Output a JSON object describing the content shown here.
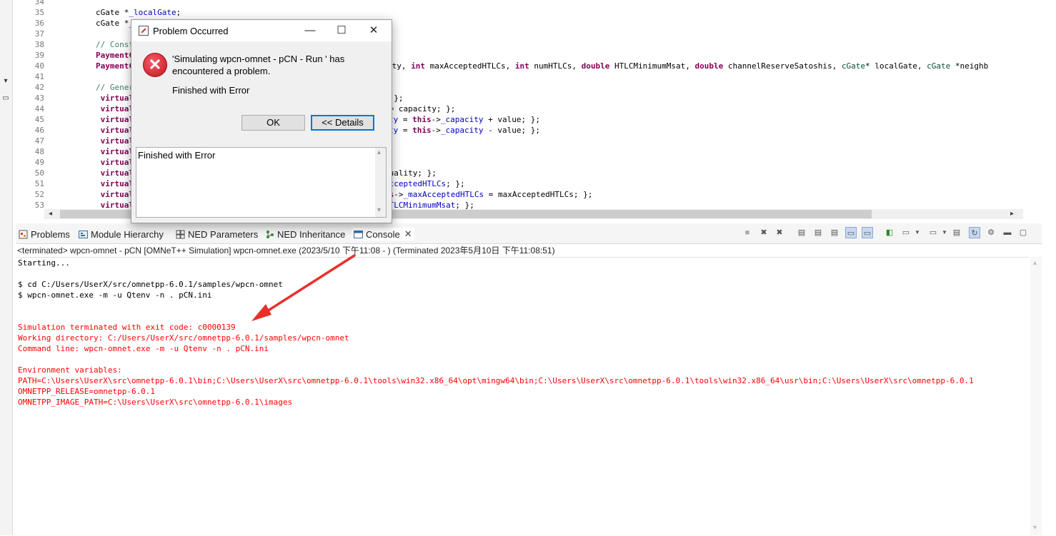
{
  "editor": {
    "lines": [
      {
        "no": "34",
        "segments": []
      },
      {
        "no": "35",
        "segments": [
          {
            "t": "        cGate *",
            "c": ""
          },
          {
            "t": "_localGate",
            "c": "fld"
          },
          {
            "t": ";",
            "c": ""
          }
        ]
      },
      {
        "no": "36",
        "segments": [
          {
            "t": "        cGate *",
            "c": ""
          },
          {
            "t": "_n",
            "c": "fld"
          }
        ]
      },
      {
        "no": "37",
        "segments": []
      },
      {
        "no": "38",
        "segments": [
          {
            "t": "        // Constr",
            "c": "cm"
          }
        ]
      },
      {
        "no": "39",
        "segments": [
          {
            "t": "        PaymentCh",
            "c": "kw"
          }
        ]
      },
      {
        "no": "40",
        "segments": [
          {
            "t": "        PaymentCh",
            "c": "kw"
          }
        ]
      },
      {
        "no": "41",
        "segments": []
      },
      {
        "no": "42",
        "segments": [
          {
            "t": "        // Generi",
            "c": "cm"
          }
        ]
      },
      {
        "no": "43",
        "segments": [
          {
            "t": "         virtual",
            "c": "kw"
          }
        ]
      },
      {
        "no": "44",
        "segments": [
          {
            "t": "         virtual",
            "c": "kw"
          }
        ]
      },
      {
        "no": "45",
        "segments": [
          {
            "t": "         virtual",
            "c": "kw"
          }
        ]
      },
      {
        "no": "46",
        "segments": [
          {
            "t": "         virtual",
            "c": "kw"
          }
        ]
      },
      {
        "no": "47",
        "segments": [
          {
            "t": "         virtual",
            "c": "kw"
          }
        ]
      },
      {
        "no": "48",
        "segments": [
          {
            "t": "         virtual",
            "c": "kw"
          }
        ]
      },
      {
        "no": "49",
        "segments": [
          {
            "t": "         virtual",
            "c": "kw"
          }
        ]
      },
      {
        "no": "50",
        "segments": [
          {
            "t": "         virtual",
            "c": "kw"
          }
        ]
      },
      {
        "no": "51",
        "segments": [
          {
            "t": "         virtual",
            "c": "kw"
          }
        ]
      },
      {
        "no": "52",
        "segments": [
          {
            "t": "         virtual",
            "c": "kw"
          }
        ]
      },
      {
        "no": "53",
        "segments": [
          {
            "t": "         virtual",
            "c": "kw"
          }
        ]
      }
    ],
    "right_fragments": [
      {
        "line": 40,
        "segments": [
          {
            "t": "ity, ",
            "c": ""
          },
          {
            "t": "int",
            "c": "kw"
          },
          {
            "t": " maxAcceptedHTLCs, ",
            "c": ""
          },
          {
            "t": "int",
            "c": "kw"
          },
          {
            "t": " numHTLCs, ",
            "c": ""
          },
          {
            "t": "double",
            "c": "kw"
          },
          {
            "t": " HTLCMinimumMsat, ",
            "c": ""
          },
          {
            "t": "double",
            "c": "kw"
          },
          {
            "t": " channelReserveSatoshis, ",
            "c": ""
          },
          {
            "t": "cGate",
            "c": "typ"
          },
          {
            "t": "* localGate, ",
            "c": ""
          },
          {
            "t": "cGate",
            "c": "typ"
          },
          {
            "t": " *neighb",
            "c": ""
          }
        ]
      },
      {
        "line": 43,
        "segments": [
          {
            "t": "; };",
            "c": ""
          }
        ]
      },
      {
        "line": 44,
        "segments": [
          {
            "t": " = capacity; };",
            "c": ""
          }
        ]
      },
      {
        "line": 45,
        "segments": [
          {
            "t": "ty",
            "c": "fld"
          },
          {
            "t": " = ",
            "c": ""
          },
          {
            "t": "this",
            "c": "kw"
          },
          {
            "t": "->",
            "c": ""
          },
          {
            "t": "_capacity",
            "c": "fld"
          },
          {
            "t": " + value; };",
            "c": ""
          }
        ]
      },
      {
        "line": 46,
        "segments": [
          {
            "t": "ty",
            "c": "fld"
          },
          {
            "t": " = ",
            "c": ""
          },
          {
            "t": "this",
            "c": "kw"
          },
          {
            "t": "->",
            "c": ""
          },
          {
            "t": "_capacity",
            "c": "fld"
          },
          {
            "t": " - value; };",
            "c": ""
          }
        ]
      },
      {
        "line": 49,
        "segments": [
          {
            "t": "};",
            "c": ""
          }
        ]
      },
      {
        "line": 50,
        "segments": [
          {
            "t": "quality; };",
            "c": ""
          }
        ]
      },
      {
        "line": 51,
        "segments": [
          {
            "t": "AcceptedHTLCs",
            "c": "fld"
          },
          {
            "t": "; };",
            "c": ""
          }
        ]
      },
      {
        "line": 52,
        "segments": [
          {
            "t": "is",
            "c": "kw"
          },
          {
            "t": "->",
            "c": ""
          },
          {
            "t": "_maxAcceptedHTLCs",
            "c": "fld"
          },
          {
            "t": " = maxAcceptedHTLCs; };",
            "c": ""
          }
        ]
      },
      {
        "line": 53,
        "segments": [
          {
            "t": "HTLCMinimumMsat",
            "c": "fld"
          },
          {
            "t": "; };",
            "c": ""
          }
        ]
      }
    ]
  },
  "panel": {
    "tabs": [
      {
        "id": "problems",
        "label": "Problems"
      },
      {
        "id": "module-hierarchy",
        "label": "Module Hierarchy"
      },
      {
        "id": "ned-parameters",
        "label": "NED Parameters"
      },
      {
        "id": "ned-inheritance",
        "label": "NED Inheritance"
      },
      {
        "id": "console",
        "label": "Console"
      }
    ],
    "status": "<terminated> wpcn-omnet - pCN [OMNeT++ Simulation] wpcn-omnet.exe (2023/5/10 下午11:08 - ) (Terminated 2023年5月10日 下午11:08:51)",
    "console_lines": [
      {
        "text": "Starting...",
        "err": false
      },
      {
        "text": "",
        "err": false
      },
      {
        "text": "$ cd C:/Users/UserX/src/omnetpp-6.0.1/samples/wpcn-omnet",
        "err": false
      },
      {
        "text": "$ wpcn-omnet.exe -m -u Qtenv -n . pCN.ini",
        "err": false
      },
      {
        "text": "",
        "err": false
      },
      {
        "text": "",
        "err": false
      },
      {
        "text": "Simulation terminated with exit code: c0000139",
        "err": true
      },
      {
        "text": "Working directory: C:/Users/UserX/src/omnetpp-6.0.1/samples/wpcn-omnet",
        "err": true
      },
      {
        "text": "Command line: wpcn-omnet.exe -m -u Qtenv -n . pCN.ini",
        "err": true
      },
      {
        "text": "",
        "err": true
      },
      {
        "text": "Environment variables:",
        "err": true
      },
      {
        "text": "PATH=C:\\Users\\UserX\\src\\omnetpp-6.0.1\\bin;C:\\Users\\UserX\\src\\omnetpp-6.0.1\\tools\\win32.x86_64\\opt\\mingw64\\bin;C:\\Users\\UserX\\src\\omnetpp-6.0.1\\tools\\win32.x86_64\\usr\\bin;C:\\Users\\UserX\\src\\omnetpp-6.0.1",
        "err": true
      },
      {
        "text": "OMNETPP_RELEASE=omnetpp-6.0.1",
        "err": true
      },
      {
        "text": "OMNETPP_IMAGE_PATH=C:\\Users\\UserX\\src\\omnetpp-6.0.1\\images",
        "err": true
      }
    ]
  },
  "dialog": {
    "title": "Problem Occurred",
    "message": "'Simulating wpcn-omnet - pCN - Run ' has encountered a problem.",
    "sub_message": "Finished with Error",
    "ok_label": "OK",
    "details_label": "<< Details",
    "details_text": "Finished with Error",
    "minimize_glyph": "—",
    "maximize_glyph": "☐",
    "close_glyph": "✕"
  },
  "colors": {
    "keyword": "#7f0055",
    "comment": "#3f7f5f",
    "field": "#0000c0",
    "error_text": "#ff0000",
    "annotation_arrow": "#e8302a"
  }
}
